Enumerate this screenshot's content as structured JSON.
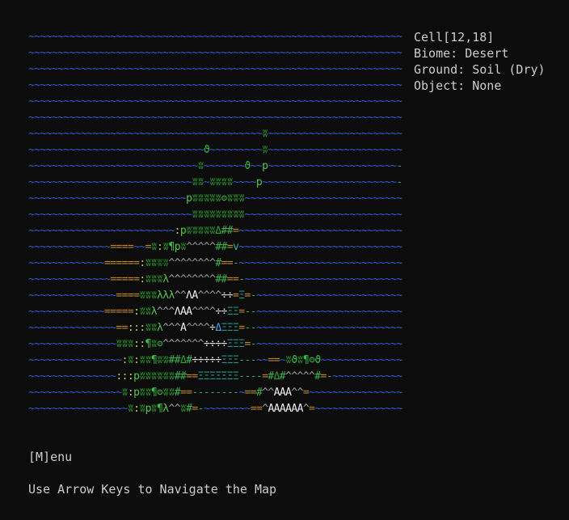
{
  "palette": {
    "~": "#2f5bd3",
    "w": "#2aa52a",
    "W": "#1f8f2a",
    "p": "#56c74d",
    "9": "#3dbb46",
    "n": "#38b24a",
    "o": "#3aa83f",
    "l": "#5bc64f",
    "d": "#2aa52a",
    "#": "#3bb44a",
    "=": "#c48c1c",
    "e": "#3aa36f",
    "-": "#3aa36f",
    "^": "#9a9a9a",
    "A": "#f0f0f0",
    "a": "#f0f0f0",
    "t": "#e6e6e6",
    "s": "#1d9a8a",
    ":": "#c8c84a",
    "v": "#36b4a0",
    "x": "#2aa52a",
    "g": "#7ac84a",
    "c": "#3dbb46",
    "b": "#4aa3e0",
    "u": "#c8c84a",
    " ": "#0c0c0c"
  },
  "glyphs": {
    "~": "~",
    "w": "ʬ",
    "W": "ʬ",
    "p": "p",
    "9": "¶",
    "n": "ϑ",
    "o": "ʘ",
    "l": "λ",
    "d": "Δ",
    "#": "#",
    "=": "=",
    "e": "=",
    "-": "-",
    "^": "^",
    "A": "A",
    "a": "Λ",
    "t": "÷",
    "s": "Ξ",
    ":": ":",
    "v": "v",
    "x": "x",
    "g": "ʬ",
    "c": "Ϙ",
    "b": "Δ",
    "u": "u",
    " ": " "
  },
  "map_rows": [
    "~~~~~~~~~~~~~~~~~~~~~~~~~~~~~~~~~~~~~~~~~~~~~~~~~~~~~~~~~~~~~~~~",
    "~~~~~~~~~~~~~~~~~~~~~~~~~~~~~~~~~~~~~~~~~~~~~~~~~~~~~~~~~~~~~~~~",
    "~~~~~~~~~~~~~~~~~~~~~~~~~~~~~~~~~~~~~~~~~~~~~~~~~~~~~~~~~~~~~~~~",
    "~~~~~~~~~~~~~~~~~~~~~~~~~~~~~~~~~~~~~~~~~~~~~~~~~~~~~~~~~~~~~~~~",
    "~~~~~~~~~~~~~~~~~~~~~~~~~~~~~~~~~~~~~~~~~~~~~~~~~~~~~~~~~~~~~~~~",
    "~~~~~~~~~~~~~~~~~~~~~~~~~~~~~~~~~~~~~~~~~~~~~~~~~~~~~~~~~~~~~~~~",
    "~~~~~~~~~~~~~~~~~~~~~~~~~~~~~~~~~~~~~~~~w~~~~~~~~~~~~~~~~~~~~~~~",
    "~~~~~~~~~~~~~~~~~~~~~~~~~~~~~~n~~~~~~~~~w~~~~~~~~~~~~~~~~~~~~~~~",
    "~~~~~~~~~~~~~~~~~~~~~~~~~~~~~w~~~~~~~n~~p~~~~~~~~~~~~~~~~~~~~~~-",
    "~~~~~~~~~~~~~~~~~~~~~~~~~~~~ww~wwww~~~~p~~~~~~~~~~~~~~~~~~~~~~~-",
    "~~~~~~~~~~~~~~~~~~~~~~~~~~~pwwwwwowww~~~~~~~~~~~~~~~~~~~~~~~~~~~",
    "~~~~~~~~~~~~~~~~~~~~~~~~~~~~wwwwwwwww~~~~~~~~~~~~~~~~~~~~~~~~~~~",
    "~~~~~~~~~~~~~~~~~~~~~~~~~:pwwwwwd##=~~~~~~~~~~~~~~~~~~~~~~~~~~~~",
    "~~~~~~~~~~~~~~====~~=w:w9pw^^^^^##=v~~~~~~~~~~~~~~~~~~~~~~~~~~~~",
    "~~~~~~~~~~~~~======:wwWW^^^^^^^^#==-~~~~~~~~~~~~~~~~~~~~~~~~~~~~",
    "~~~~~~~~~~~~~~=====:wwwl^^^^^^^^##==-~~~~~~~~~~~~~~~~~~~~~~~~~~~",
    "~~~~~~~~~~~~~~~====wwwlll^^aA^^^^tt=s=-~~~~~~~~~~~~~~~~~~~~~~~~~",
    "~~~~~~~~~~~~~=====:wwl^^^aAA^^^^ttss=--~~~~~~~~~~~~~~~~~~~~~~~~~",
    "~~~~~~~~~~~~~~~==:::wwl^^^A^^^^tbsss=--~~~~~~~~~~~~~~~~~~~~~~~~~",
    "~~~~~~~~~~~~~~~www::9wo^^^^^^^ttttsss=-~~~~~~~~~~~~~~~~~~~~~~~~~",
    "~~~~~~~~~~~~~~~~:w:ww9ww##d#tttttsss---~~==~wnw9on~~~~~~~~~~~~~~",
    "~~~~~~~~~~~~~~~:::pwwwwww##==sssssss----=#d#^^^^^#=-~~~~~~~~~~~~",
    "~~~~~~~~~~~~~~~~w:pww9oww#==--------~==#^^AAA^^=~~~~~~~~~~~~~~~~",
    "~~~~~~~~~~~~~~~~~w:wpw9l^^w#=-~~~~~~~~==^AAAAAA^=~~~~~~~~~~~~~~~"
  ],
  "cell_info": {
    "cell": "Cell[12,18]",
    "biome": "Biome: Desert",
    "ground": "Ground: Soil (Dry)",
    "object": "Object: None"
  },
  "menu_hint": "[M]enu",
  "nav_hint": "Use Arrow Keys to Navigate the Map"
}
